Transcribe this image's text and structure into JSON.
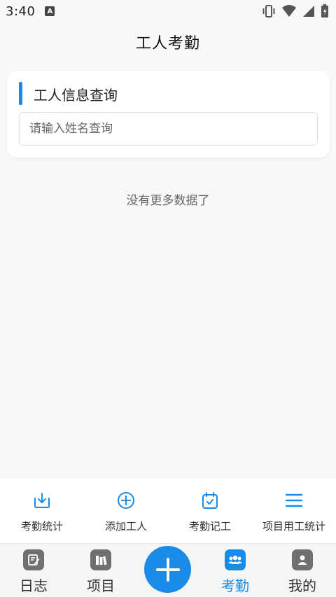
{
  "status_bar": {
    "time": "3:40",
    "notification_icon": "A",
    "icons": [
      "vibrate-icon",
      "wifi-icon",
      "signal-icon",
      "battery-icon"
    ]
  },
  "header": {
    "title": "工人考勤"
  },
  "search_card": {
    "title": "工人信息查询",
    "placeholder": "请输入姓名查询",
    "value": ""
  },
  "list": {
    "empty_message": "没有更多数据了"
  },
  "actions": [
    {
      "label": "考勤统计",
      "icon": "download-icon"
    },
    {
      "label": "添加工人",
      "icon": "add-circle-icon"
    },
    {
      "label": "考勤记工",
      "icon": "calendar-check-icon"
    },
    {
      "label": "项目用工统计",
      "icon": "menu-list-icon"
    }
  ],
  "bottom_nav": {
    "items": [
      {
        "label": "日志",
        "icon": "log-icon",
        "active": false
      },
      {
        "label": "项目",
        "icon": "project-icon",
        "active": false
      },
      {
        "label": "考勤",
        "icon": "attendance-icon",
        "active": true
      },
      {
        "label": "我的",
        "icon": "profile-icon",
        "active": false
      }
    ],
    "fab_icon": "plus-icon"
  },
  "colors": {
    "accent": "#1a8be6",
    "background": "#f7f8fa",
    "inactive_icon": "#707070"
  }
}
